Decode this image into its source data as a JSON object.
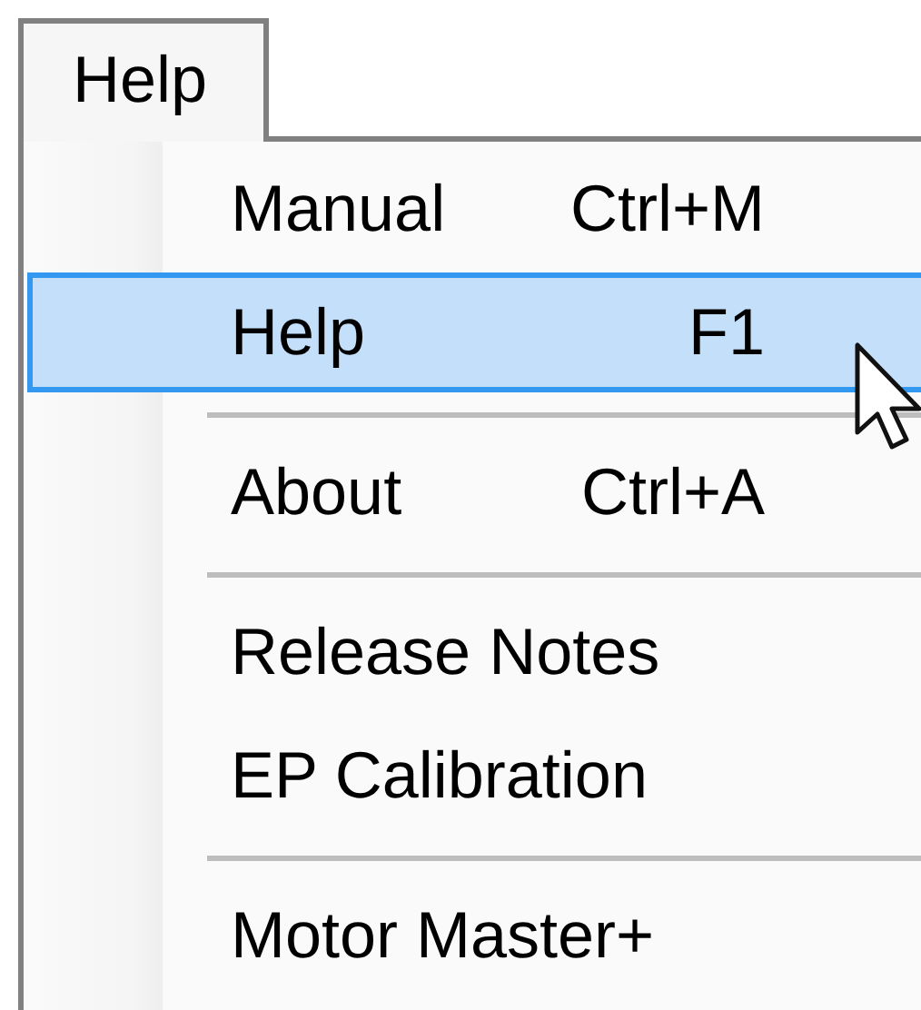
{
  "menu_bar": [
    {
      "label": "Help",
      "selected": true
    }
  ],
  "menu": {
    "items": [
      {
        "kind": "item",
        "label": "Manual",
        "shortcut": "Ctrl+M",
        "selected": false
      },
      {
        "kind": "item",
        "label": "Help",
        "shortcut": "F1",
        "selected": true
      },
      {
        "kind": "separator"
      },
      {
        "kind": "item",
        "label": "About",
        "shortcut": "Ctrl+A",
        "selected": false
      },
      {
        "kind": "separator"
      },
      {
        "kind": "item",
        "label": "Release Notes",
        "selected": false
      },
      {
        "kind": "item",
        "label": "EP Calibration",
        "selected": false
      },
      {
        "kind": "separator"
      },
      {
        "kind": "item",
        "label": "Motor Master+",
        "selected": false
      }
    ]
  }
}
